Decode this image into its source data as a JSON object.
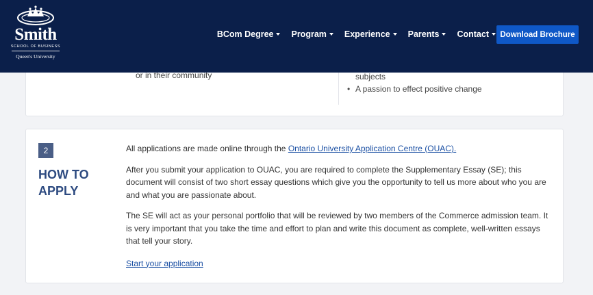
{
  "header": {
    "logo": {
      "word": "Smith",
      "school": "SCHOOL OF BUSINESS",
      "university": "Queen's University"
    },
    "nav": [
      {
        "label": "BCom Degree"
      },
      {
        "label": "Program"
      },
      {
        "label": "Experience"
      },
      {
        "label": "Parents"
      },
      {
        "label": "Contact"
      }
    ],
    "cta_label": "Download Brochure",
    "colors": {
      "background": "#0b1f4a",
      "cta": "#0f58c7"
    }
  },
  "card1": {
    "left_fragment": "or in their community",
    "right_fragment_1": "subjects",
    "right_bullet": "A passion to effect positive change"
  },
  "card2": {
    "step_number": "2",
    "title": "HOW TO APPLY",
    "para1_prefix": "All applications are made online through the ",
    "para1_link": "Ontario University Application Centre (OUAC).",
    "para2": "After you submit your application to OUAC, you are required to complete the Supplementary Essay (SE); this document will consist of two short essay questions which give you the opportunity to tell us more about who you are and what you are passionate about.",
    "para3": "The SE will act as your personal portfolio that will be reviewed by two members of the Commerce admission team. It is very important that you take the time and effort to plan and write this document as complete, well-written essays that tell your story.",
    "start_link": "Start your application"
  }
}
